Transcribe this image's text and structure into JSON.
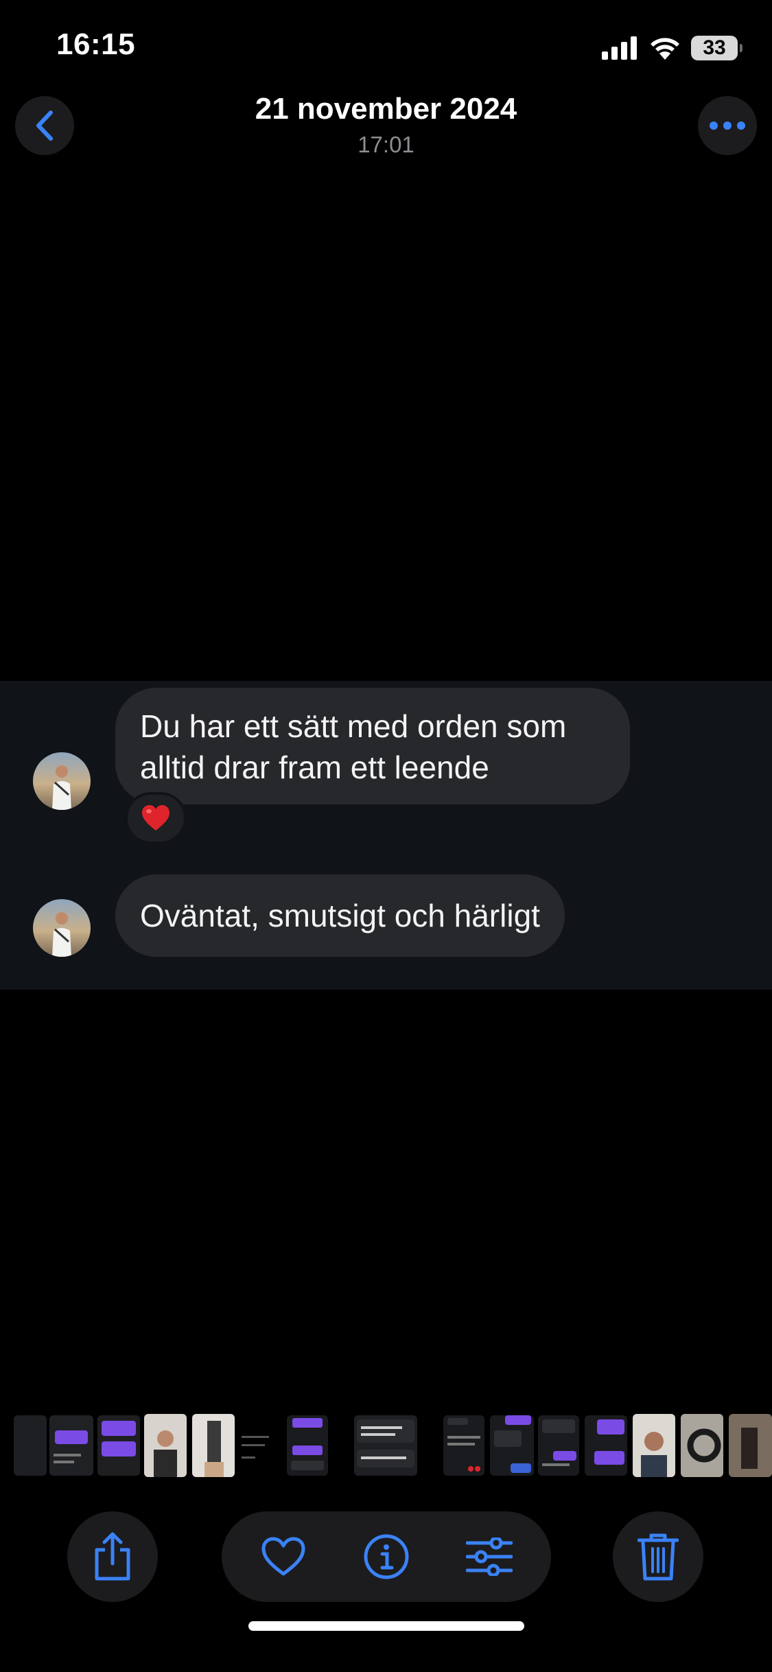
{
  "status_bar": {
    "time": "16:15",
    "battery_percent": "33",
    "signal_icon": "cellular-signal-icon",
    "wifi_icon": "wifi-icon"
  },
  "header": {
    "title": "21 november 2024",
    "subtitle": "17:01",
    "back_icon": "chevron-left-icon",
    "more_icon": "ellipsis-icon"
  },
  "messages": [
    {
      "text": "Du har ett sätt med orden som alltid drar fram ett leende",
      "reaction": "❤️"
    },
    {
      "text": "Oväntat, smutsigt och härligt"
    }
  ],
  "toolbar": {
    "share_icon": "share-icon",
    "favorite_icon": "heart-icon",
    "info_icon": "info-icon",
    "adjust_icon": "sliders-icon",
    "delete_icon": "trash-icon"
  },
  "colors": {
    "accent": "#3a82f7",
    "background": "#000000",
    "message_panel": "#101317",
    "bubble": "#26282c",
    "control_bg": "#1c1c1e"
  }
}
